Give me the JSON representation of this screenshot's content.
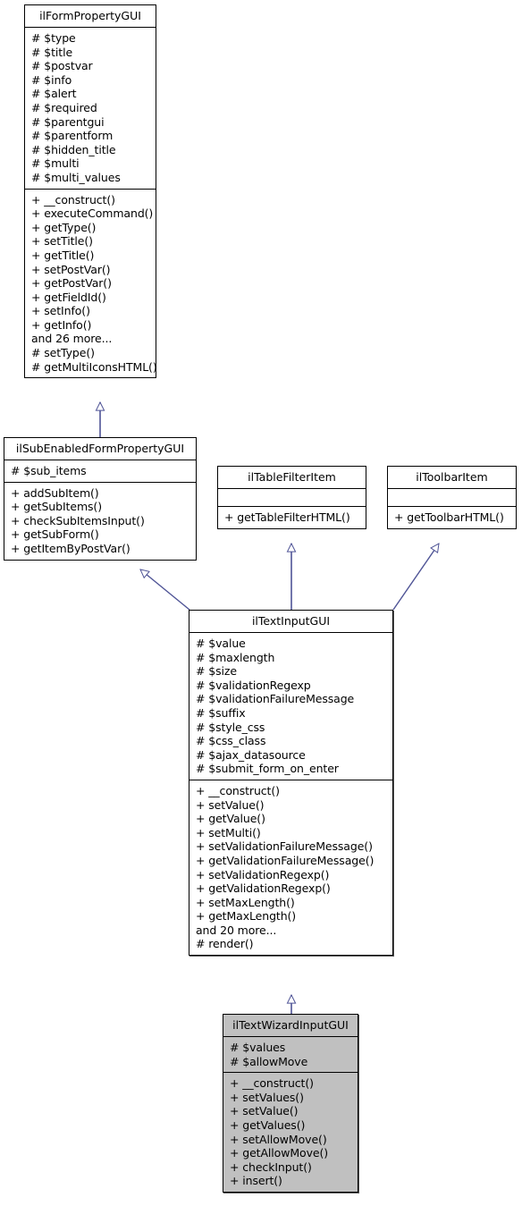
{
  "diagram": {
    "type": "uml-class-inheritance-diagram",
    "background_color": "#ffffff",
    "connector_color": "#4f5496",
    "highlight_color": "#c0c0c0",
    "border_color": "#000000"
  },
  "classes": {
    "form_property": {
      "name": "ilFormPropertyGUI",
      "attributes": [
        "# $type",
        "# $title",
        "# $postvar",
        "# $info",
        "# $alert",
        "# $required",
        "# $parentgui",
        "# $parentform",
        "# $hidden_title",
        "# $multi",
        "# $multi_values"
      ],
      "methods": [
        "+ __construct()",
        "+ executeCommand()",
        "+ getType()",
        "+ setTitle()",
        "+ getTitle()",
        "+ setPostVar()",
        "+ getPostVar()",
        "+ getFieldId()",
        "+ setInfo()",
        "+ getInfo()",
        "and 26 more...",
        "# setType()",
        "# getMultiIconsHTML()"
      ]
    },
    "sub_enabled_form_property": {
      "name": "ilSubEnabledFormPropertyGUI",
      "attributes": [
        "# $sub_items"
      ],
      "methods": [
        "+ addSubItem()",
        "+ getSubItems()",
        "+ checkSubItemsInput()",
        "+ getSubForm()",
        "+ getItemByPostVar()"
      ]
    },
    "table_filter_item": {
      "name": "ilTableFilterItem",
      "attributes": [],
      "methods": [
        "+ getTableFilterHTML()"
      ]
    },
    "toolbar_item": {
      "name": "ilToolbarItem",
      "attributes": [],
      "methods": [
        "+ getToolbarHTML()"
      ]
    },
    "text_input": {
      "name": "ilTextInputGUI",
      "attributes": [
        "# $value",
        "# $maxlength",
        "# $size",
        "# $validationRegexp",
        "# $validationFailureMessage",
        "# $suffix",
        "# $style_css",
        "# $css_class",
        "# $ajax_datasource",
        "# $submit_form_on_enter"
      ],
      "methods": [
        "+ __construct()",
        "+ setValue()",
        "+ getValue()",
        "+ setMulti()",
        "+ setValidationFailureMessage()",
        "+ getValidationFailureMessage()",
        "+ setValidationRegexp()",
        "+ getValidationRegexp()",
        "+ setMaxLength()",
        "+ getMaxLength()",
        "and 20 more...",
        "# render()"
      ]
    },
    "text_wizard_input": {
      "name": "ilTextWizardInputGUI",
      "attributes": [
        "# $values",
        "# $allowMove"
      ],
      "methods": [
        "+ __construct()",
        "+ setValues()",
        "+ setValue()",
        "+ getValues()",
        "+ setAllowMove()",
        "+ getAllowMove()",
        "+ checkInput()",
        "+ insert()"
      ]
    }
  },
  "relationships": [
    {
      "from": "ilSubEnabledFormPropertyGUI",
      "to": "ilFormPropertyGUI",
      "kind": "generalization"
    },
    {
      "from": "ilTextInputGUI",
      "to": "ilSubEnabledFormPropertyGUI",
      "kind": "generalization"
    },
    {
      "from": "ilTextInputGUI",
      "to": "ilTableFilterItem",
      "kind": "generalization"
    },
    {
      "from": "ilTextInputGUI",
      "to": "ilToolbarItem",
      "kind": "generalization"
    },
    {
      "from": "ilTextWizardInputGUI",
      "to": "ilTextInputGUI",
      "kind": "generalization"
    }
  ]
}
